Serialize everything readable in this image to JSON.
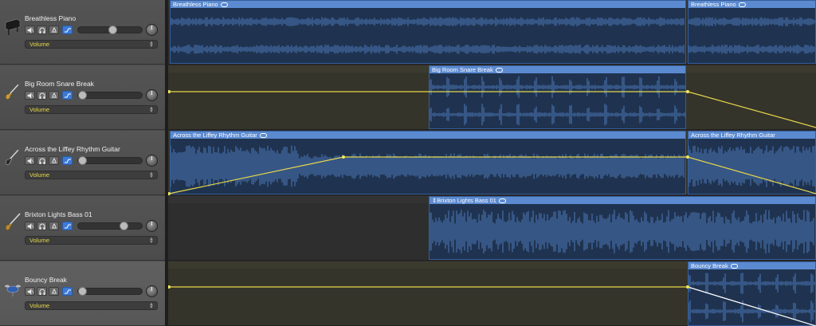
{
  "tracks": [
    {
      "name": "Breathless Piano",
      "instrument_icon": "piano-icon",
      "automation_param": "Volume",
      "regions": [
        {
          "name": "Breathless Piano",
          "looped": true
        },
        {
          "name": "Breathless Piano",
          "looped": true
        }
      ]
    },
    {
      "name": "Big Room Snare Break",
      "instrument_icon": "electric-guitar-icon",
      "automation_param": "Volume",
      "regions": [
        {
          "name": "Big Room Snare Break",
          "looped": true
        }
      ]
    },
    {
      "name": "Across the Liffey Rhythm Guitar",
      "instrument_icon": "electric-guitar-icon",
      "automation_param": "Volume",
      "regions": [
        {
          "name": "Across the Liffey Rhythm Guitar",
          "looped": true
        },
        {
          "name": "Across the Liffey Rhythm Guitar",
          "looped": false
        }
      ]
    },
    {
      "name": "Brixton Lights Bass 01",
      "instrument_icon": "bass-guitar-icon",
      "automation_param": "Volume",
      "regions": [
        {
          "name": "Brixton Lights Bass 01",
          "looped": true
        }
      ]
    },
    {
      "name": "Bouncy Break",
      "instrument_icon": "drum-kit-icon",
      "automation_param": "Volume",
      "regions": [
        {
          "name": "Bouncy Break",
          "looped": true
        }
      ]
    }
  ],
  "controls": {
    "mute_icon": "mute-icon",
    "solo_icon": "headphones-solo-icon",
    "input_icon": "input-monitor-icon",
    "automation_icon": "automation-icon"
  },
  "colors": {
    "region_header": "#5b8ad0",
    "region_body": "#1f3350",
    "automation_line": "#e8d84a",
    "automation_lane": "#35342a"
  }
}
